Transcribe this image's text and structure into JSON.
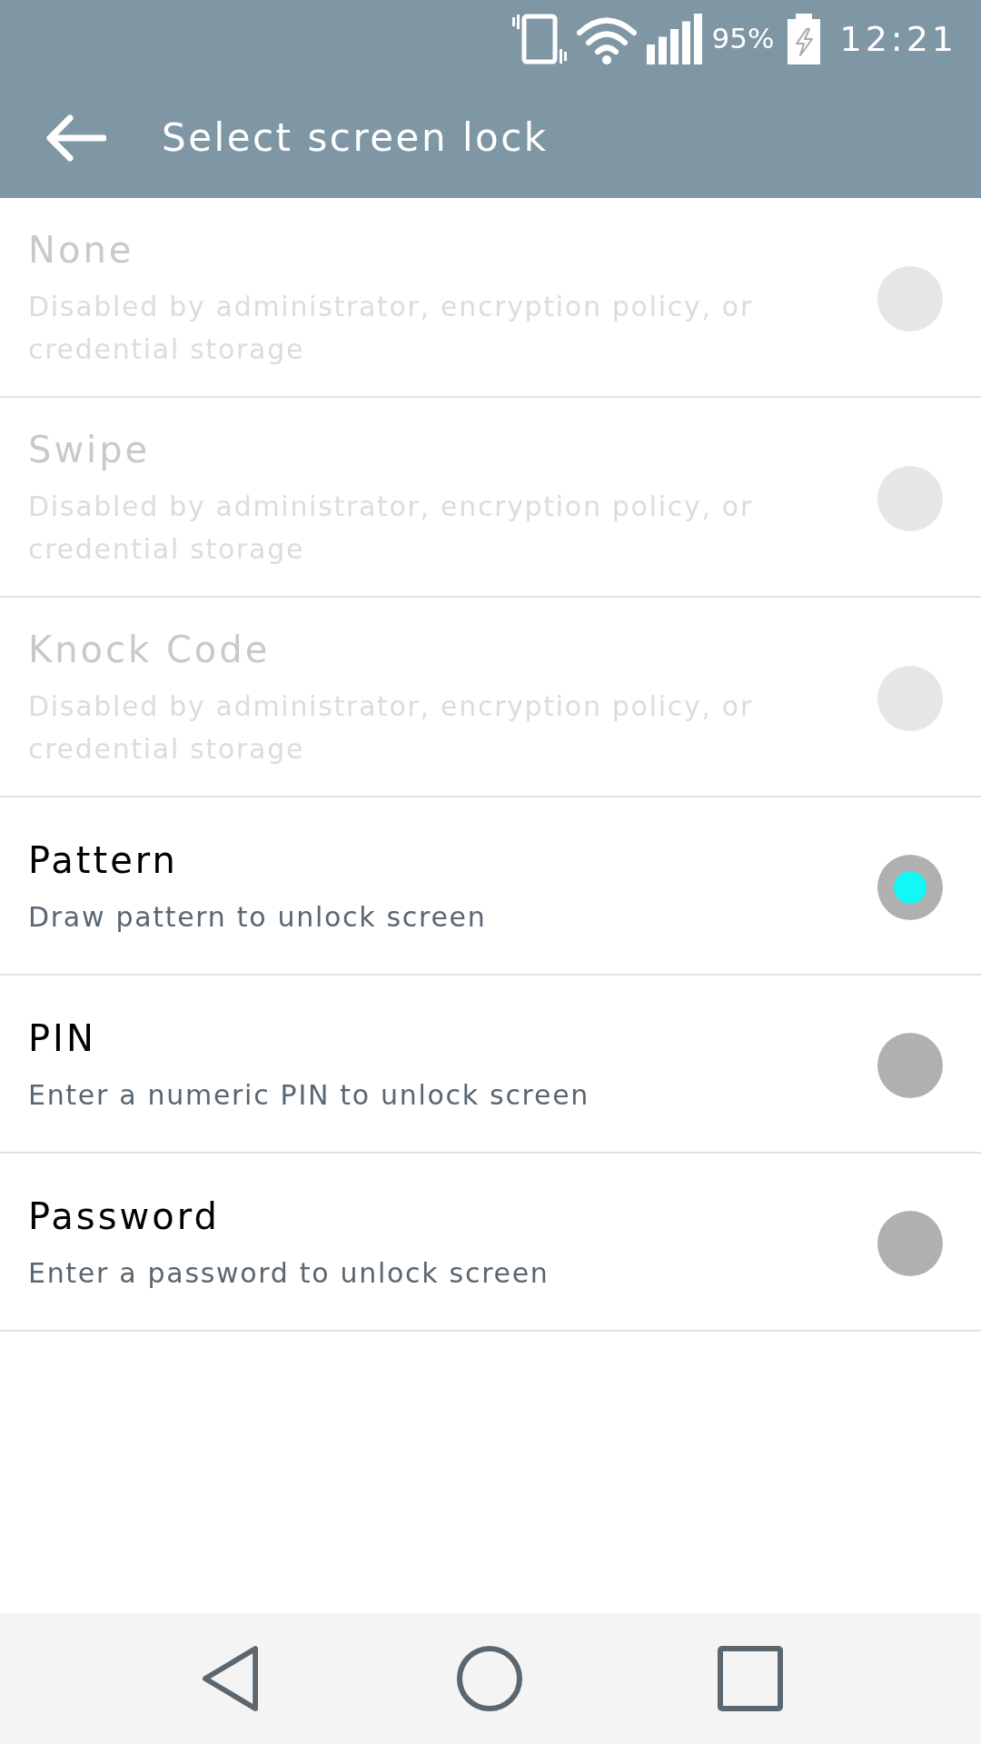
{
  "status_bar": {
    "battery": "95%",
    "time": "12:21"
  },
  "toolbar": {
    "title": "Select screen lock"
  },
  "options": [
    {
      "title": "None",
      "summary": "Disabled by administrator, encryption policy, or credential storage",
      "disabled": true,
      "selected": false
    },
    {
      "title": "Swipe",
      "summary": "Disabled by administrator, encryption policy, or credential storage",
      "disabled": true,
      "selected": false
    },
    {
      "title": "Knock Code",
      "summary": "Disabled by administrator, encryption policy, or credential storage",
      "disabled": true,
      "selected": false
    },
    {
      "title": "Pattern",
      "summary": "Draw pattern to unlock screen",
      "disabled": false,
      "selected": true
    },
    {
      "title": "PIN",
      "summary": "Enter a numeric PIN to unlock screen",
      "disabled": false,
      "selected": false
    },
    {
      "title": "Password",
      "summary": "Enter a password to unlock screen",
      "disabled": false,
      "selected": false
    }
  ]
}
